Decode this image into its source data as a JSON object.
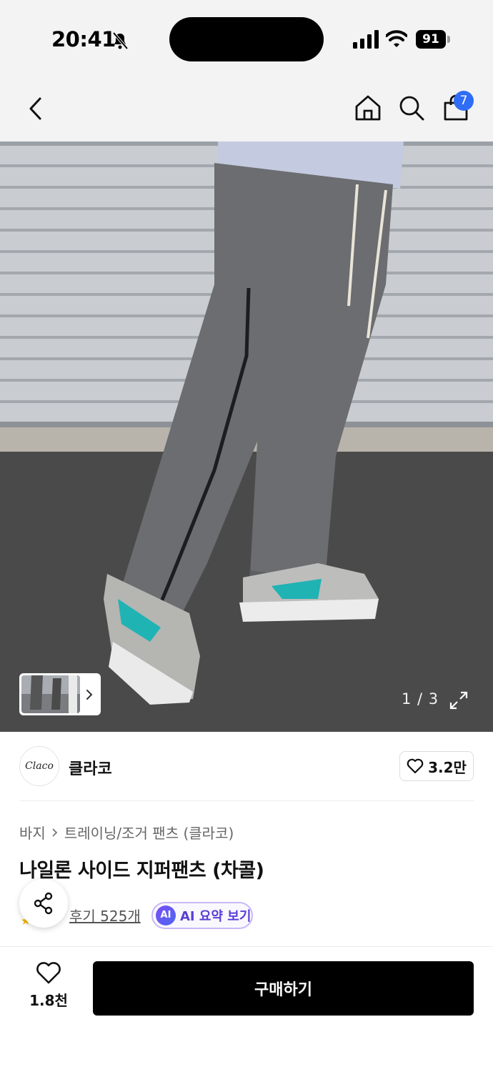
{
  "status_bar": {
    "time": "20:41",
    "battery": "91",
    "icons": [
      "bell-muted-icon",
      "cellular-signal-icon",
      "wifi-icon",
      "battery-icon"
    ]
  },
  "nav": {
    "icons": [
      "back-arrow-icon",
      "home-icon",
      "search-icon",
      "shopping-bag-icon"
    ],
    "cart_count": "7"
  },
  "gallery": {
    "counter": "1 / 3",
    "icons": [
      "thumbnail-next-icon",
      "expand-icon"
    ]
  },
  "brand": {
    "logo_text": "Claco",
    "name": "클라코",
    "likes": "3.2만"
  },
  "product": {
    "breadcrumb": [
      "바지",
      "트레이닝/조거 팬츠 (클라코)"
    ],
    "title": "나일론 사이드 지퍼팬츠 (차콜)",
    "review_link": "후기 525개",
    "ai_badge": "AI",
    "ai_summary": "AI 요약 보기"
  },
  "bottom": {
    "wish_count": "1.8천",
    "buy_label": "구매하기"
  },
  "colors": {
    "accent_badge": "#2f6df6",
    "ai_purple": "#5a3fd6",
    "buy_button": "#000000",
    "topbar_bg": "#f3f3f3"
  }
}
